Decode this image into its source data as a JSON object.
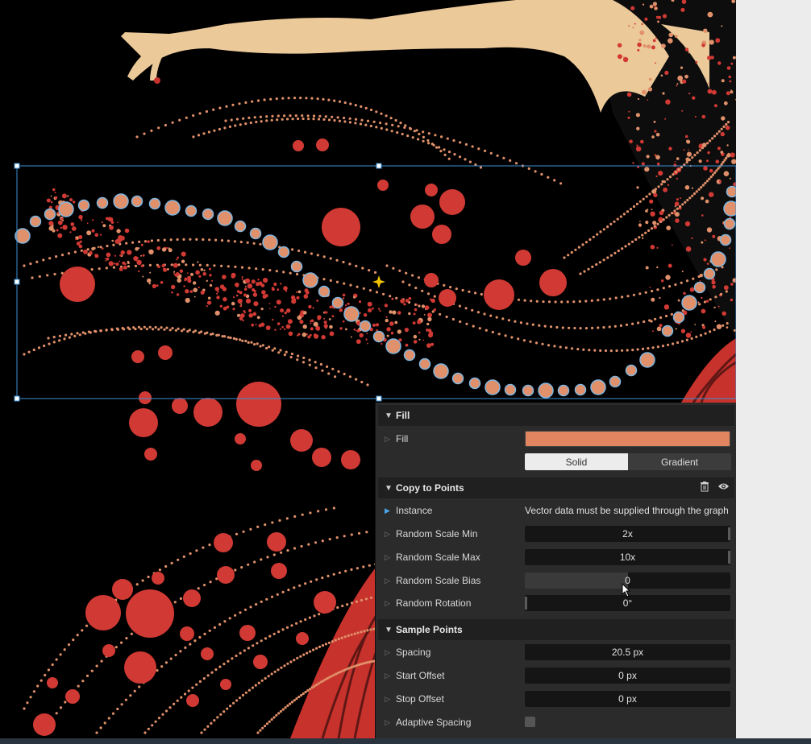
{
  "colors": {
    "fill_color": "#e0855f",
    "panel_bg": "#2b2b2b",
    "header_bg": "#202020",
    "selection": "#3b8fd4",
    "accent_red": "#d13a34",
    "bead": "#e0906a"
  },
  "fill_section": {
    "title": "Fill",
    "fill_label": "Fill",
    "mode_solid": "Solid",
    "mode_gradient": "Gradient"
  },
  "copy_section": {
    "title": "Copy to Points",
    "delete_icon": "trash-icon",
    "visibility_icon": "eye-icon",
    "instance_label": "Instance",
    "instance_note": "Vector data must be supplied through the graph",
    "scale_min_label": "Random Scale Min",
    "scale_min_value": "2x",
    "scale_max_label": "Random Scale Max",
    "scale_max_value": "10x",
    "scale_bias_label": "Random Scale Bias",
    "scale_bias_value": "0",
    "scale_bias_fraction": 0.5,
    "rotation_label": "Random Rotation",
    "rotation_value": "0°"
  },
  "sample_section": {
    "title": "Sample Points",
    "spacing_label": "Spacing",
    "spacing_value": "20.5 px",
    "start_label": "Start Offset",
    "start_value": "0 px",
    "stop_label": "Stop Offset",
    "stop_value": "0 px",
    "adaptive_label": "Adaptive Spacing",
    "adaptive_checked": false
  }
}
